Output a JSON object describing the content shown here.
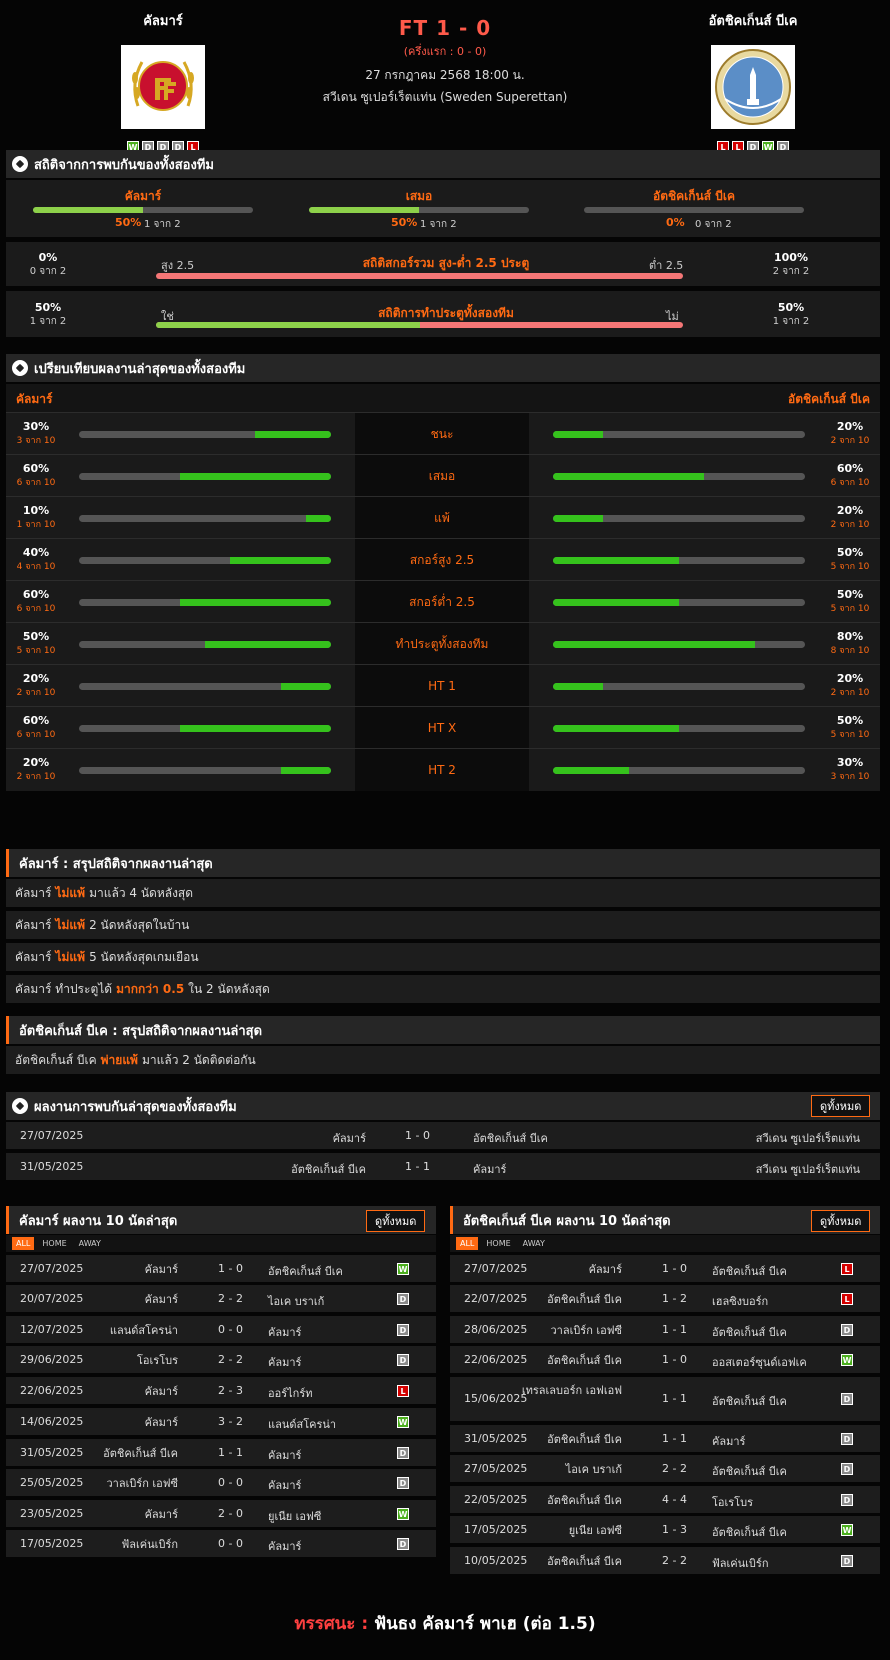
{
  "home": {
    "name": "คัลมาร์",
    "form": [
      "W",
      "D",
      "D",
      "D",
      "L"
    ]
  },
  "away": {
    "name": "อัตชิคเก็นส์ บีเค",
    "form": [
      "L",
      "L",
      "D",
      "W",
      "D"
    ]
  },
  "match": {
    "score": "FT 1 - 0",
    "ht": "(ครึ่งแรก : 0 - 0)",
    "date": "27 กรกฎาคม 2568 18:00 น.",
    "league": "สวีเดน ซูเปอร์เร็ตแท่น (Sweden Superettan)"
  },
  "h2h_stats": {
    "title": "สถิติจากการพบกันของทั้งสองทีม",
    "cols": [
      {
        "label": "คัลมาร์",
        "pct": "50%",
        "sub": "1 จาก 2",
        "fill": 50
      },
      {
        "label": "เสมอ",
        "pct": "50%",
        "sub": "1 จาก 2",
        "fill": 50
      },
      {
        "label": "อัตชิคเก็นส์ บีเค",
        "pct": "0%",
        "sub": "0 จาก 2",
        "fill": 0
      }
    ]
  },
  "ou_stats": {
    "title": "สถิติสกอร์รวม สูง-ต่ำ 2.5 ประตู",
    "left_pct": "0%",
    "left_sub": "0 จาก 2",
    "right_pct": "100%",
    "right_sub": "2 จาก 2",
    "left_label": "สูง 2.5",
    "right_label": "ต่ำ 2.5",
    "fill": 0
  },
  "btts_stats": {
    "title": "สถิติการทำประตูทั้งสองทีม",
    "left_pct": "50%",
    "left_sub": "1 จาก 2",
    "right_pct": "50%",
    "right_sub": "1 จาก 2",
    "left_label": "ใช่",
    "right_label": "ไม่",
    "fill": 50
  },
  "compare": {
    "title": "เปรียบเทียบผลงานล่าสุดของทั้งสองทีม",
    "home": "คัลมาร์",
    "away": "อัตชิคเก็นส์ บีเค",
    "rows": [
      {
        "label": "ชนะ",
        "lp": "30%",
        "ls": "3 จาก 10",
        "lf": 30,
        "rp": "20%",
        "rs": "2 จาก 10",
        "rf": 20
      },
      {
        "label": "เสมอ",
        "lp": "60%",
        "ls": "6 จาก 10",
        "lf": 60,
        "rp": "60%",
        "rs": "6 จาก 10",
        "rf": 60
      },
      {
        "label": "แพ้",
        "lp": "10%",
        "ls": "1 จาก 10",
        "lf": 10,
        "rp": "20%",
        "rs": "2 จาก 10",
        "rf": 20
      },
      {
        "label": "สกอร์สูง 2.5",
        "lp": "40%",
        "ls": "4 จาก 10",
        "lf": 40,
        "rp": "50%",
        "rs": "5 จาก 10",
        "rf": 50
      },
      {
        "label": "สกอร์ต่ำ 2.5",
        "lp": "60%",
        "ls": "6 จาก 10",
        "lf": 60,
        "rp": "50%",
        "rs": "5 จาก 10",
        "rf": 50
      },
      {
        "label": "ทำประตูทั้งสองทีม",
        "lp": "50%",
        "ls": "5 จาก 10",
        "lf": 50,
        "rp": "80%",
        "rs": "8 จาก 10",
        "rf": 80
      },
      {
        "label": "HT 1",
        "lp": "20%",
        "ls": "2 จาก 10",
        "lf": 20,
        "rp": "20%",
        "rs": "2 จาก 10",
        "rf": 20
      },
      {
        "label": "HT X",
        "lp": "60%",
        "ls": "6 จาก 10",
        "lf": 60,
        "rp": "50%",
        "rs": "5 จาก 10",
        "rf": 50
      },
      {
        "label": "HT 2",
        "lp": "20%",
        "ls": "2 จาก 10",
        "lf": 20,
        "rp": "30%",
        "rs": "3 จาก 10",
        "rf": 30
      }
    ]
  },
  "home_summary": {
    "title": "คัลมาร์ : สรุปสถิติจากผลงานล่าสุด",
    "lines": [
      {
        "a": "คัลมาร์",
        "b": "ไม่แพ้",
        "c": "มาแล้ว 4 นัดหลังสุด"
      },
      {
        "a": "คัลมาร์",
        "b": "ไม่แพ้",
        "c": "2  นัดหลังสุดในบ้าน"
      },
      {
        "a": "คัลมาร์",
        "b": "ไม่แพ้",
        "c": "5  นัดหลังสุดเกมเยือน"
      },
      {
        "a": "คัลมาร์  ทำประตูได้",
        "b": "มากกว่า  0.5",
        "c": "ใน 2 นัดหลังสุด"
      }
    ]
  },
  "away_summary": {
    "title": "อัตชิคเก็นส์ บีเค : สรุปสถิติจากผลงานล่าสุด",
    "lines": [
      {
        "a": "อัตชิคเก็นส์ บีเค",
        "b": "พ่ายแพ้",
        "c": "มาแล้ว 2 นัดติดต่อกัน"
      }
    ]
  },
  "h2h_results": {
    "title": "ผลงานการพบกันล่าสุดของทั้งสองทีม",
    "btn": "ดูทั้งหมด",
    "rows": [
      {
        "date": "27/07/2025",
        "home": "คัลมาร์",
        "score": "1 - 0",
        "away": "อัตชิคเก็นส์ บีเค",
        "league": "สวีเดน ซูเปอร์เร็ตแท่น"
      },
      {
        "date": "31/05/2025",
        "home": "อัตชิคเก็นส์ บีเค",
        "score": "1 - 1",
        "away": "คัลมาร์",
        "league": "สวีเดน ซูเปอร์เร็ตแท่น"
      }
    ]
  },
  "home_last10": {
    "title": "คัลมาร์ ผลงาน 10 นัดล่าสุด",
    "btn": "ดูทั้งหมด",
    "tabs": [
      "ALL",
      "HOME",
      "AWAY"
    ],
    "rows": [
      {
        "date": "27/07/2025",
        "home": "คัลมาร์",
        "score": "1 - 0",
        "away": "อัตชิคเก็นส์ บีเค",
        "res": "W"
      },
      {
        "date": "20/07/2025",
        "home": "คัลมาร์",
        "score": "2 - 2",
        "away": "ไอเค บราเก้",
        "res": "D"
      },
      {
        "date": "12/07/2025",
        "home": "แลนด์สโครน่า",
        "score": "0 - 0",
        "away": "คัลมาร์",
        "res": "D"
      },
      {
        "date": "29/06/2025",
        "home": "โอเรโบร",
        "score": "2 - 2",
        "away": "คัลมาร์",
        "res": "D"
      },
      {
        "date": "22/06/2025",
        "home": "คัลมาร์",
        "score": "2 - 3",
        "away": "ออร์ไกร์ท",
        "res": "L"
      },
      {
        "date": "14/06/2025",
        "home": "คัลมาร์",
        "score": "3 - 2",
        "away": "แลนด์สโครน่า",
        "res": "W"
      },
      {
        "date": "31/05/2025",
        "home": "อัตชิคเก็นส์ บีเค",
        "score": "1 - 1",
        "away": "คัลมาร์",
        "res": "D"
      },
      {
        "date": "25/05/2025",
        "home": "วาลเบิร์ก เอฟซี",
        "score": "0 - 0",
        "away": "คัลมาร์",
        "res": "D"
      },
      {
        "date": "23/05/2025",
        "home": "คัลมาร์",
        "score": "2 - 0",
        "away": "ยูเนีย เอฟซี",
        "res": "W"
      },
      {
        "date": "17/05/2025",
        "home": "ฟัลเค่นเบิร์ก",
        "score": "0 - 0",
        "away": "คัลมาร์",
        "res": "D"
      }
    ]
  },
  "away_last10": {
    "title": "อัตชิคเก็นส์ บีเค ผลงาน 10 นัดล่าสุด",
    "btn": "ดูทั้งหมด",
    "tabs": [
      "ALL",
      "HOME",
      "AWAY"
    ],
    "rows": [
      {
        "date": "27/07/2025",
        "home": "คัลมาร์",
        "score": "1 - 0",
        "away": "อัตชิคเก็นส์ บีเค",
        "res": "L"
      },
      {
        "date": "22/07/2025",
        "home": "อัตชิคเก็นส์ บีเค",
        "score": "1 - 2",
        "away": "เฮลซิงบอร์ก",
        "res": "L"
      },
      {
        "date": "28/06/2025",
        "home": "วาลเบิร์ก เอฟซี",
        "score": "1 - 1",
        "away": "อัตชิคเก็นส์ บีเค",
        "res": "D"
      },
      {
        "date": "22/06/2025",
        "home": "อัตชิคเก็นส์ บีเค",
        "score": "1 - 0",
        "away": "ออสเตอร์ซุนด์เอฟเค",
        "res": "W"
      },
      {
        "date": "15/06/2025",
        "home": "เทรลเลบอร์ก เอฟเอฟ",
        "score": "1 - 1",
        "away": "อัตชิคเก็นส์ บีเค",
        "res": "D"
      },
      {
        "date": "31/05/2025",
        "home": "อัตชิคเก็นส์ บีเค",
        "score": "1 - 1",
        "away": "คัลมาร์",
        "res": "D"
      },
      {
        "date": "27/05/2025",
        "home": "ไอเค บราเก้",
        "score": "2 - 2",
        "away": "อัตชิคเก็นส์ บีเค",
        "res": "D"
      },
      {
        "date": "22/05/2025",
        "home": "อัตชิคเก็นส์ บีเค",
        "score": "4 - 4",
        "away": "โอเรโบร",
        "res": "D"
      },
      {
        "date": "17/05/2025",
        "home": "ยูเนีย เอฟซี",
        "score": "1 - 3",
        "away": "อัตชิคเก็นส์ บีเค",
        "res": "W"
      },
      {
        "date": "10/05/2025",
        "home": "อัตชิคเก็นส์ บีเค",
        "score": "2 - 2",
        "away": "ฟัลเค่นเบิร์ก",
        "res": "D"
      }
    ]
  },
  "verdict": {
    "label": "ทรรศนะ",
    "sep": ":",
    "text": "ฟันธง คัลมาร์ พาเฮ (ต่อ 1.5)"
  },
  "icons": {
    "section": "soccer-ball-icon"
  },
  "colors": {
    "accent": "#ff6a13",
    "green": "#35c21c",
    "win": "#4caf1e",
    "draw": "#8a8a8a",
    "loss": "#d40000"
  }
}
